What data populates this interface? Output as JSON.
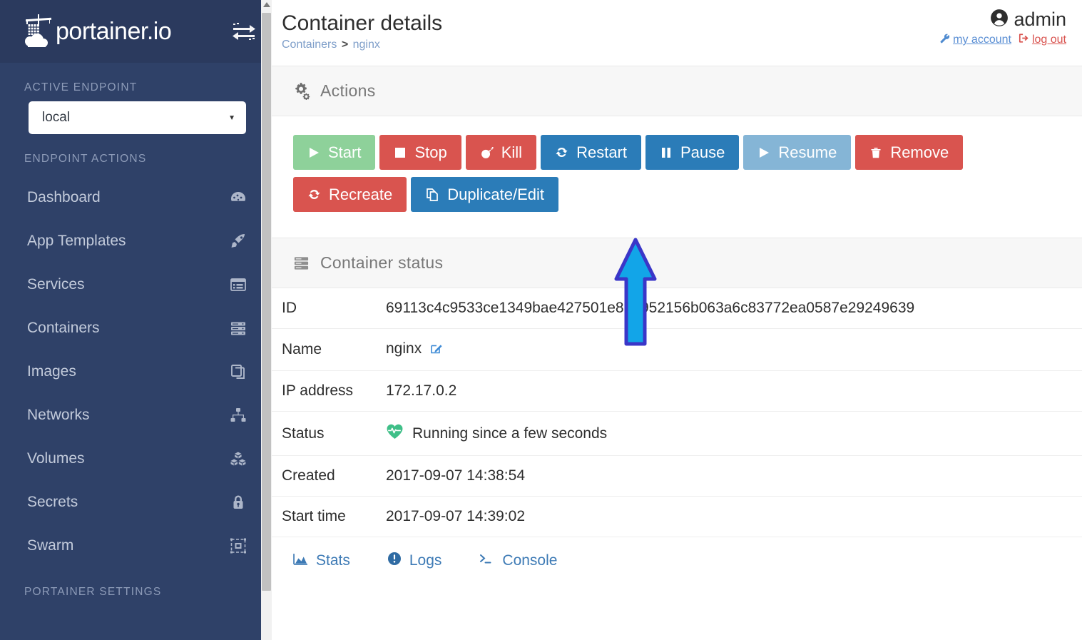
{
  "sidebar": {
    "brand": "portainer.io",
    "brand_icon": "portainer-whale-crane-logo",
    "toggle_icon": "switch-arrows-icon",
    "section_active_endpoint": "ACTIVE ENDPOINT",
    "endpoint_value": "local",
    "endpoint_caret_icon": "chevron-down-icon",
    "section_endpoint_actions": "ENDPOINT ACTIONS",
    "items": [
      {
        "label": "Dashboard",
        "icon": "dashboard-gauge-icon"
      },
      {
        "label": "App Templates",
        "icon": "rocket-icon"
      },
      {
        "label": "Services",
        "icon": "list-panel-icon"
      },
      {
        "label": "Containers",
        "icon": "server-stack-icon"
      },
      {
        "label": "Images",
        "icon": "copy-layers-icon"
      },
      {
        "label": "Networks",
        "icon": "sitemap-icon"
      },
      {
        "label": "Volumes",
        "icon": "cubes-icon"
      },
      {
        "label": "Secrets",
        "icon": "lock-key-icon"
      },
      {
        "label": "Swarm",
        "icon": "swarm-object-group-icon"
      }
    ],
    "section_portainer_settings": "PORTAINER SETTINGS"
  },
  "header": {
    "title": "Container details",
    "breadcrumb": {
      "parent": "Containers",
      "separator": ">",
      "current": "nginx"
    },
    "user": {
      "name": "admin",
      "avatar_icon": "user-circle-icon",
      "my_account_label": "my account",
      "my_account_icon": "wrench-icon",
      "log_out_label": "log out",
      "log_out_icon": "sign-out-icon"
    }
  },
  "actions_panel": {
    "title": "Actions",
    "icon": "cogs-icon",
    "buttons": [
      {
        "label": "Start",
        "icon": "play-icon",
        "style": "btn-green"
      },
      {
        "label": "Stop",
        "icon": "stop-square-icon",
        "style": "btn-red"
      },
      {
        "label": "Kill",
        "icon": "bomb-icon",
        "style": "btn-red"
      },
      {
        "label": "Restart",
        "icon": "refresh-icon",
        "style": "btn-blue"
      },
      {
        "label": "Pause",
        "icon": "pause-icon",
        "style": "btn-blue"
      },
      {
        "label": "Resume",
        "icon": "play-icon",
        "style": "btn-lblue"
      },
      {
        "label": "Remove",
        "icon": "trash-icon",
        "style": "btn-red"
      },
      {
        "label": "Recreate",
        "icon": "refresh-icon",
        "style": "btn-red"
      },
      {
        "label": "Duplicate/Edit",
        "icon": "files-copy-icon",
        "style": "btn-blue"
      }
    ]
  },
  "status_panel": {
    "title": "Container status",
    "icon": "server-stack-icon",
    "rows": [
      {
        "key": "ID",
        "value": "69113c4c9533ce1349bae427501e860952156b063a6c83772ea0587e29249639"
      },
      {
        "key": "Name",
        "value": "nginx",
        "edit_icon": "edit-pencil-square-icon"
      },
      {
        "key": "IP address",
        "value": "172.17.0.2"
      },
      {
        "key": "Status",
        "value": "Running since a few seconds",
        "status_icon": "heartbeat-icon",
        "status_color": "#3fbf88"
      },
      {
        "key": "Created",
        "value": "2017-09-07 14:38:54"
      },
      {
        "key": "Start time",
        "value": "2017-09-07 14:39:02"
      }
    ],
    "footer_links": [
      {
        "label": "Stats",
        "icon": "area-chart-icon"
      },
      {
        "label": "Logs",
        "icon": "info-circle-icon"
      },
      {
        "label": "Console",
        "icon": "terminal-prompt-icon"
      }
    ]
  },
  "annotation": {
    "arrow_icon": "up-arrow-annotation",
    "fill_color": "#12a5e8",
    "stroke_color": "#3a36c8",
    "points_at": "Recreate"
  },
  "colors": {
    "sidebar_bg": "#2f4168",
    "sidebar_logo_bg": "#2b3a5e",
    "accent_blue": "#2b7cb8",
    "danger_red": "#d9544f",
    "success_green": "#8ed19a",
    "light_blue": "#85b5d6"
  }
}
